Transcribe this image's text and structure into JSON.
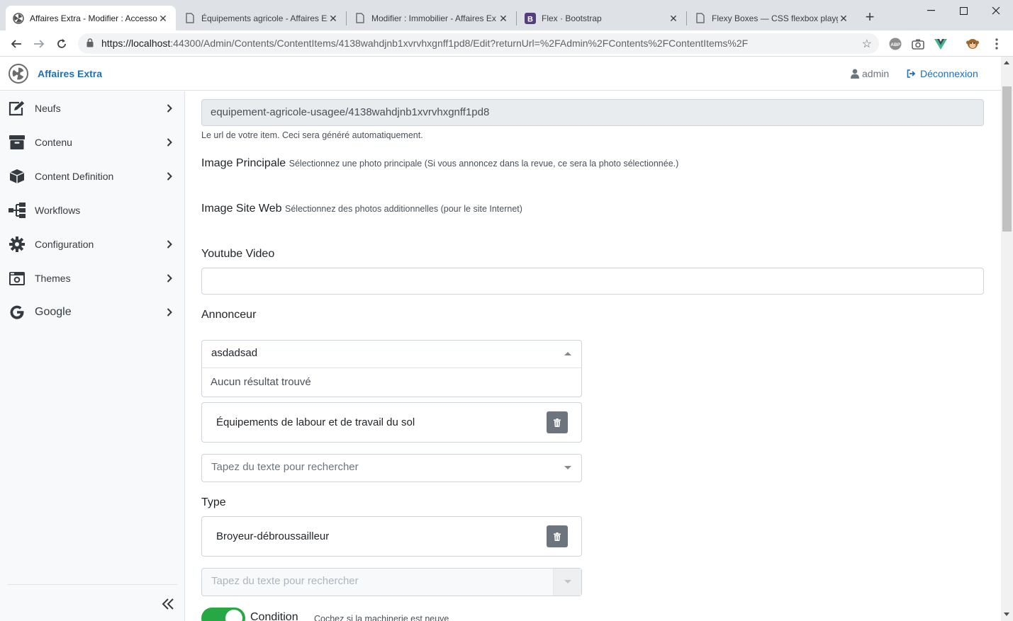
{
  "browser": {
    "tabs": [
      {
        "title": "Affaires Extra - Modifier : Accesso",
        "active": true
      },
      {
        "title": "Équipements agricole - Affaires Ex",
        "active": false
      },
      {
        "title": "Modifier : Immobilier - Affaires Ex",
        "active": false
      },
      {
        "title": "Flex · Bootstrap",
        "active": false
      },
      {
        "title": "Flexy Boxes — CSS flexbox playgr",
        "active": false
      }
    ],
    "url_host": "https://localhost",
    "url_rest": ":44300/Admin/Contents/ContentItems/4138wahdjnb1xvrvhxgnff1pd8/Edit?returnUrl=%2FAdmin%2FContents%2FContentItems%2F"
  },
  "app": {
    "brand": "Affaires Extra",
    "user": "admin",
    "logout": "Déconnexion"
  },
  "sidebar": {
    "items": [
      {
        "label": "Neufs",
        "icon": "edit-icon",
        "chevron": true
      },
      {
        "label": "Contenu",
        "icon": "archive-icon",
        "chevron": true
      },
      {
        "label": "Content Definition",
        "icon": "cube-icon",
        "chevron": true
      },
      {
        "label": "Workflows",
        "icon": "sitemap-icon",
        "chevron": false
      },
      {
        "label": "Configuration",
        "icon": "cog-icon",
        "chevron": true
      },
      {
        "label": "Themes",
        "icon": "camera-retro-icon",
        "chevron": true
      },
      {
        "label": "Google",
        "icon": "google-icon",
        "chevron": true
      }
    ]
  },
  "form": {
    "permalink_value": "equipement-agricole-usagee/4138wahdjnb1xvrvhxgnff1pd8",
    "permalink_help": "Le url de votre item. Ceci sera généré automatiquement.",
    "image_principale_label": "Image Principale",
    "image_principale_hint": "Sélectionnez une photo principale (Si vous annoncez dans la revue, ce sera la photo sélectionnée.)",
    "image_site_label": "Image Site Web",
    "image_site_hint": "Sélectionnez des photos additionnelles (pour le site Internet)",
    "youtube_label": "Youtube Video",
    "youtube_value": "",
    "annonceur_label": "Annonceur",
    "annonceur_search": "asdadsad",
    "annonceur_no_result": "Aucun résultat trouvé",
    "categorie_item": "Équipements de labour et de travail du sol",
    "search_placeholder": "Tapez du texte pour rechercher",
    "type_label": "Type",
    "type_item": "Broyeur-débroussailleur",
    "type_search_placeholder": "Tapez du texte pour rechercher",
    "condition_label": "Condition",
    "condition_hint": "Cochez si la machinerie est neuve",
    "condition_on": true
  },
  "colors": {
    "brand": "#1f6fb5",
    "toggle_on": "#28a745",
    "trash_button": "#6c757d"
  }
}
